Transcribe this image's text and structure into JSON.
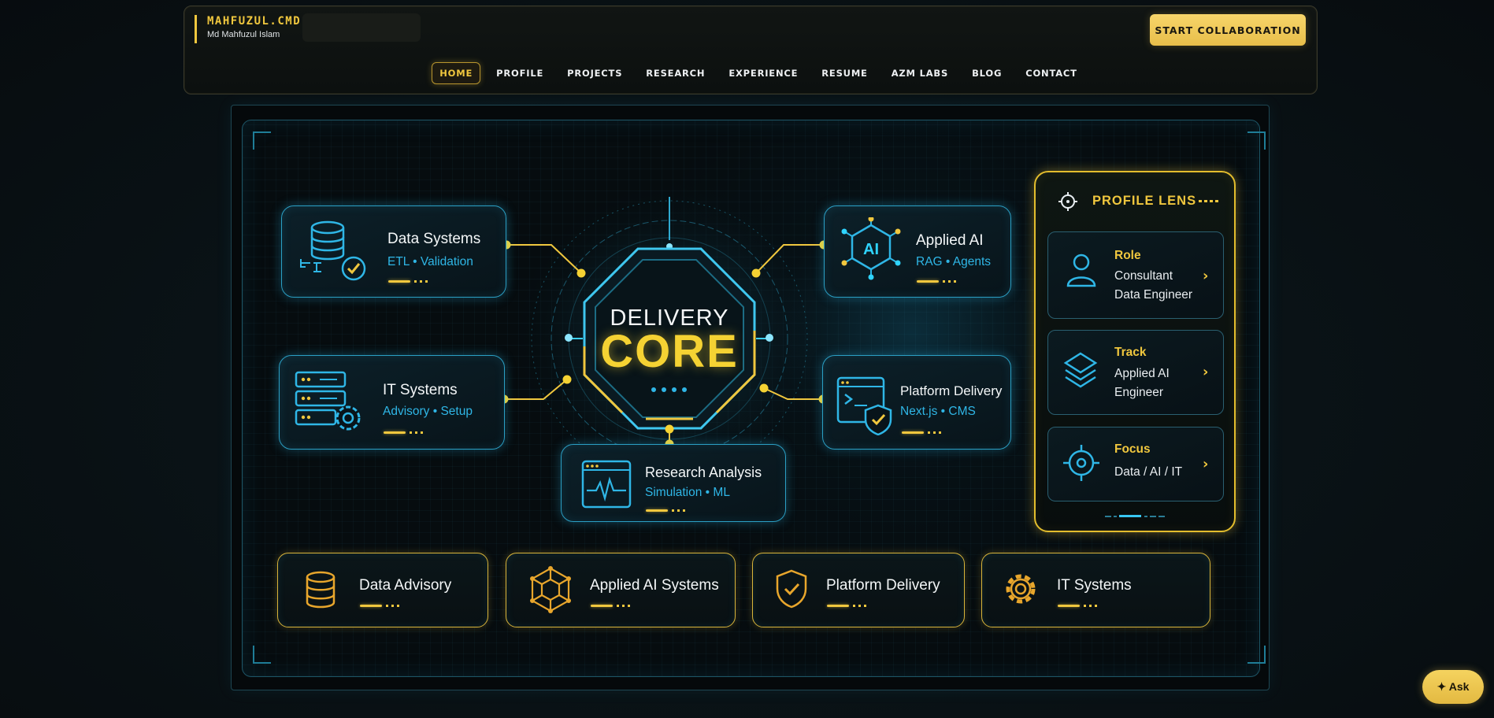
{
  "header": {
    "brand_title": "MAHFUZUL.CMD",
    "brand_subtitle": "Md Mahfuzul Islam",
    "cta_label": "START COLLABORATION",
    "nav": [
      {
        "label": "HOME",
        "active": true
      },
      {
        "label": "PROFILE"
      },
      {
        "label": "PROJECTS"
      },
      {
        "label": "RESEARCH"
      },
      {
        "label": "EXPERIENCE"
      },
      {
        "label": "RESUME"
      },
      {
        "label": "AZM LABS"
      },
      {
        "label": "BLOG"
      },
      {
        "label": "CONTACT"
      }
    ]
  },
  "hero": {
    "core_title": "DELIVERY",
    "core_main": "CORE",
    "nodes": [
      {
        "title": "Data Systems",
        "subtitle": "ETL • Validation",
        "icon": "database-check-icon"
      },
      {
        "title": "Applied AI",
        "subtitle": "RAG • Agents",
        "icon": "ai-chip-icon"
      },
      {
        "title": "IT Systems",
        "subtitle": "Advisory • Setup",
        "icon": "server-gear-icon"
      },
      {
        "title": "Platform Delivery",
        "subtitle": "Next.js • CMS",
        "icon": "code-shield-icon"
      },
      {
        "title": "Research Analysis",
        "subtitle": "Simulation • ML",
        "icon": "waveform-window-icon"
      }
    ],
    "lens": {
      "title": "PROFILE LENS",
      "items": [
        {
          "label": "Role",
          "line1": "Consultant",
          "line2": "Data Engineer",
          "icon": "user-icon"
        },
        {
          "label": "Track",
          "line1": "Applied AI",
          "line2": "Engineer",
          "icon": "layers-icon"
        },
        {
          "label": "Focus",
          "line1": "Data / AI / IT",
          "line2": "",
          "icon": "target-icon"
        }
      ]
    },
    "services": [
      {
        "title": "Data Advisory",
        "icon": "database-icon"
      },
      {
        "title": "Applied AI Systems",
        "icon": "network-cube-icon"
      },
      {
        "title": "Platform Delivery",
        "icon": "shield-check-icon"
      },
      {
        "title": "IT Systems",
        "icon": "gear-icon"
      }
    ]
  },
  "ask_label": "Ask",
  "colors": {
    "accent": "#f0c73e",
    "cyan": "#2fb6e6",
    "background": "#070c0f"
  }
}
